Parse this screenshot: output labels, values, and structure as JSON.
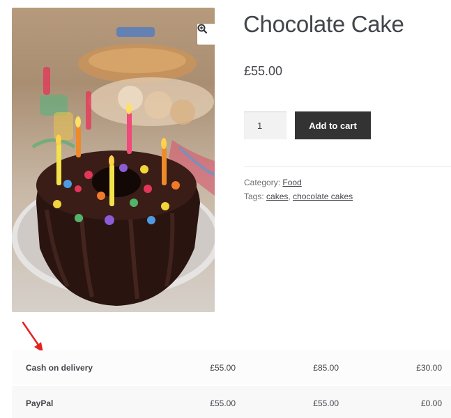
{
  "product": {
    "title": "Chocolate Cake",
    "price": "£55.00",
    "quantity": "1",
    "add_to_cart_label": "Add to cart",
    "image_alt": "Chocolate bundt cake with colorful candles and candy"
  },
  "meta": {
    "category_label": "Category:",
    "category_link": "Food",
    "tags_label": "Tags:",
    "tags": [
      "cakes",
      "chocolate cakes"
    ],
    "tags_separator": ","
  },
  "payments": {
    "rows": [
      {
        "method": "Cash on delivery",
        "col1": "£55.00",
        "col2": "£85.00",
        "col3": "£30.00"
      },
      {
        "method": "PayPal",
        "col1": "£55.00",
        "col2": "£55.00",
        "col3": "£0.00"
      }
    ]
  },
  "icons": {
    "zoom": "magnifier-plus-icon",
    "annotation": "red-arrow-icon"
  },
  "colors": {
    "button_bg": "#333333",
    "button_text": "#ffffff",
    "text": "#43454b",
    "annotation_red": "#e32222"
  }
}
